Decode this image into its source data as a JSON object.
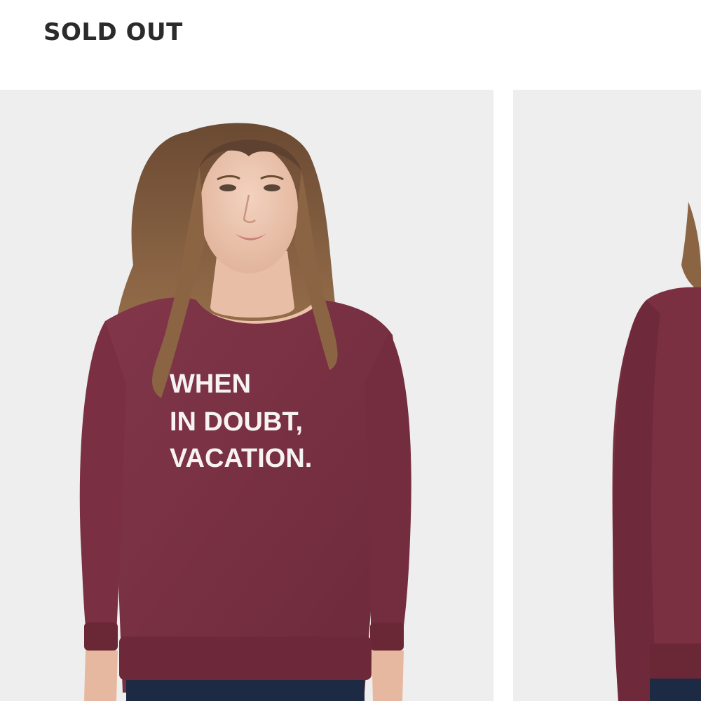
{
  "product": {
    "status_label": "SOLD OUT"
  },
  "gallery": {
    "images": [
      {
        "shirt_print_lines": [
          "WHEN",
          "IN DOUBT,",
          "VACATION."
        ]
      },
      {}
    ]
  },
  "colors": {
    "background": "#ffffff",
    "photo_background": "#eeeeee",
    "sweatshirt": "#7a3040",
    "status_text": "#2b2b2b"
  }
}
